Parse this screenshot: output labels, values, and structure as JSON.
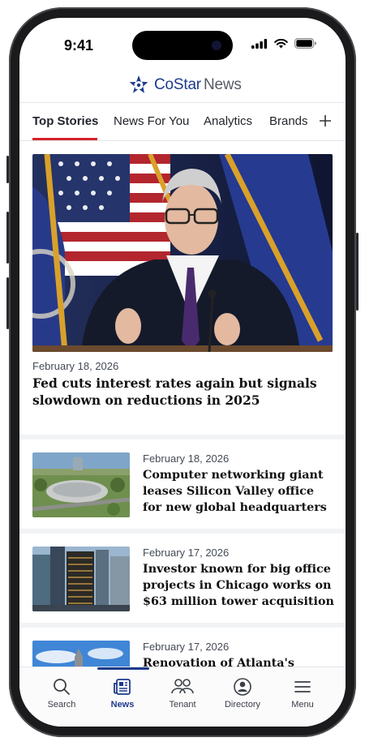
{
  "status_bar": {
    "time": "9:41"
  },
  "brand": {
    "name": "CoStar",
    "product": "News",
    "color": "#1d3b8a"
  },
  "tabs": [
    {
      "label": "Top Stories",
      "active": true
    },
    {
      "label": "News For You"
    },
    {
      "label": "Analytics"
    },
    {
      "label": "Brands"
    }
  ],
  "add_tab_icon": "plus-icon",
  "accent_color": "#d6222a",
  "hero": {
    "date": "February 18, 2026",
    "title": "Fed cuts interest rates again but signals slowdown on reductions in 2025"
  },
  "articles": [
    {
      "date": "February 18, 2026",
      "title": "Computer networking giant leases Silicon Valley office for new global headquarters"
    },
    {
      "date": "February 17, 2026",
      "title": "Investor known for big office projects in Chicago works on $63 million tower acquisition"
    },
    {
      "date": "February 17, 2026",
      "title": "Renovation of Atlanta's tallest building helps nab law firm"
    }
  ],
  "tab_bar": [
    {
      "label": "Search",
      "icon": "search-icon"
    },
    {
      "label": "News",
      "icon": "news-icon",
      "active": true
    },
    {
      "label": "Tenant",
      "icon": "tenant-icon"
    },
    {
      "label": "Directory",
      "icon": "directory-icon"
    },
    {
      "label": "Menu",
      "icon": "menu-icon"
    }
  ]
}
